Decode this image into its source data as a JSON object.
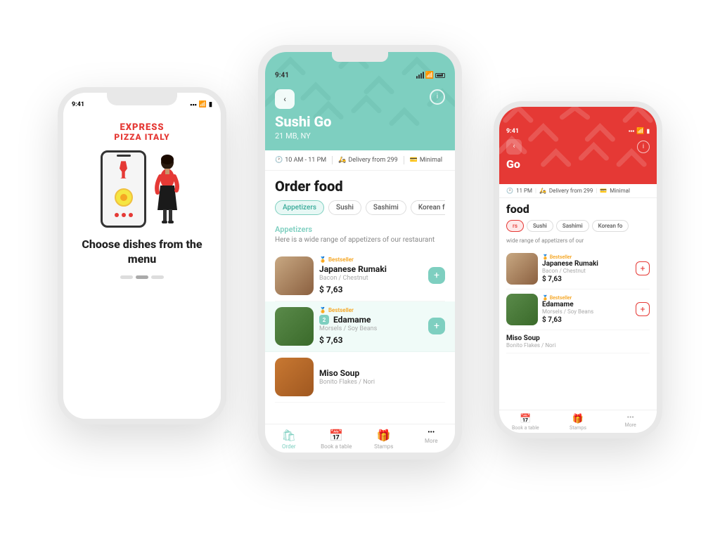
{
  "left_phone": {
    "time": "9:41",
    "logo_line1": "EXPRESS",
    "logo_line2": "PIZZA ITALY",
    "choose_text": "Choose dishes from the menu"
  },
  "center_phone": {
    "time": "9:41",
    "restaurant_name": "Sushi Go",
    "restaurant_location": "21 MB, NY",
    "hours": "10 AM - 11 PM",
    "delivery_from": "Delivery from 299",
    "minimal": "Minimal",
    "order_food_title": "Order food",
    "categories": [
      "Appetizers",
      "Sushi",
      "Sashimi",
      "Korean fo..."
    ],
    "section_title": "Appetizers",
    "section_desc": "Here is a wide range of appetizers of our restaurant",
    "items": [
      {
        "badge": "Bestseller",
        "name": "Japanese Rumaki",
        "desc": "Bacon / Chestnut",
        "price": "$ 7,63",
        "quantity": null,
        "highlighted": false,
        "img_color": "brown"
      },
      {
        "badge": "Bestseller",
        "name": "Edamame",
        "desc": "Morsels / Soy Beans",
        "price": "$ 7,63",
        "quantity": "2",
        "highlighted": true,
        "img_color": "green"
      },
      {
        "badge": null,
        "name": "Miso Soup",
        "desc": "Bonito Flakes / Nori",
        "price": null,
        "quantity": null,
        "highlighted": false,
        "img_color": "orange"
      }
    ],
    "nav_items": [
      {
        "label": "Order",
        "icon": "🛍",
        "active": true
      },
      {
        "label": "Book a table",
        "icon": "📅",
        "active": false
      },
      {
        "label": "Stamps",
        "icon": "🎁",
        "active": false
      },
      {
        "label": "More",
        "icon": "•••",
        "active": false
      }
    ]
  },
  "right_phone": {
    "time": "9:41",
    "delivery_label": "Delivery from 299",
    "minimal_label": "Minimal",
    "hours": "11 PM",
    "order_food_title": "food",
    "section_desc": "wide range of appetizers of our",
    "categories": [
      "rs",
      "Sushi",
      "Sashimi",
      "Korean fo..."
    ],
    "items": [
      {
        "badge": "Bestseller",
        "name": "Japanese Rumaki",
        "desc": "Bacon / Chestnut",
        "price": "$ 7,63",
        "img_color": "brown"
      },
      {
        "badge": "Bestseller",
        "name": "Edamame",
        "desc": "Morsels / Soy Beans",
        "price": "$ 7,63",
        "img_color": "green"
      }
    ],
    "nav_items": [
      {
        "label": "Book a table",
        "icon": "📅"
      },
      {
        "label": "Stamps",
        "icon": "🎁"
      },
      {
        "label": "More",
        "icon": "•••"
      }
    ]
  }
}
